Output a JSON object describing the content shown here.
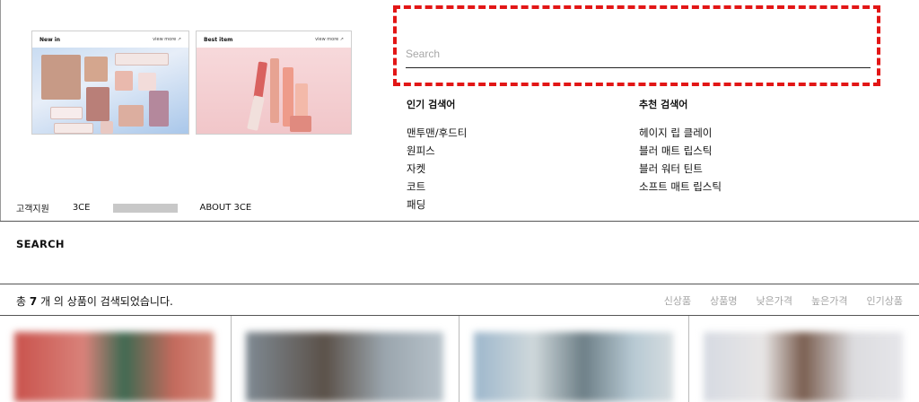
{
  "promo": {
    "new_in": {
      "title": "New in",
      "view_more": "view more ↗"
    },
    "best_item": {
      "title": "Best item",
      "view_more": "view more ↗"
    }
  },
  "sub_links": [
    "고객지원",
    "3CE",
    "ABOUT 3CE"
  ],
  "search": {
    "placeholder": "Search",
    "value": ""
  },
  "keywords": {
    "popular": {
      "heading": "인기 검색어",
      "items": [
        "맨투맨/후드티",
        "원피스",
        "자켓",
        "코트",
        "패딩"
      ]
    },
    "recommended": {
      "heading": "추천 검색어",
      "items": [
        "헤이지 립 클레이",
        "블러 매트 립스틱",
        "블러 워터 틴트",
        "소프트 매트 립스틱"
      ]
    }
  },
  "page_title": "SEARCH",
  "result": {
    "prefix": "총",
    "count": "7",
    "mid": "개 의",
    "suffix": "상품이 검색되었습니다."
  },
  "sort_options": [
    "신상품",
    "상품명",
    "낮은가격",
    "높은가격",
    "인기상품"
  ],
  "colors": {
    "accent_dash": "#e21616"
  }
}
